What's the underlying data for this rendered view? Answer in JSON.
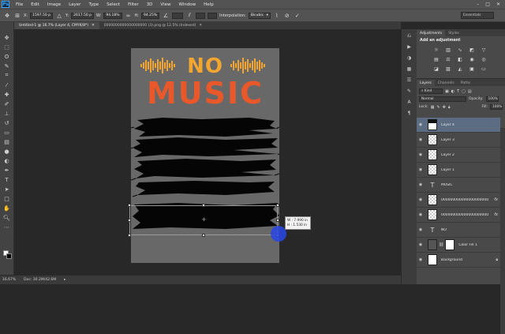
{
  "app": {
    "logo": "Ps"
  },
  "menu": [
    "File",
    "Edit",
    "Image",
    "Layer",
    "Type",
    "Select",
    "Filter",
    "3D",
    "View",
    "Window",
    "Help"
  ],
  "options": {
    "x_label": "X:",
    "x_value": "1597.50 p",
    "y_label": "Y:",
    "y_value": "2617.50 p",
    "w_label": "W:",
    "w_value": "94.18%",
    "h_label": "H:",
    "h_value": "94.25%",
    "interp_label": "Interpolation:",
    "interp_value": "Bicubic",
    "workspace": "Essentials"
  },
  "tabs": [
    {
      "label": "Untitled-1 @ 16.7% (Layer 4, CMYK/8*)",
      "active": true
    },
    {
      "label": "0000000000000000000 (3).png @ 12.5% (Indexed)",
      "active": false
    }
  ],
  "canvas": {
    "title_line1": "NO",
    "title_line2": "MUSIC",
    "transform_tooltip": {
      "w": "W : 7.990 in",
      "h": "H : 1.530 in"
    }
  },
  "status": {
    "zoom": "16.67%",
    "doc": "Doc: 30.2M/42.6M"
  },
  "right_panel": {
    "tabs": [
      "Adjustments",
      "Styles"
    ],
    "add_adjustment": "Add an adjustment",
    "layers_tabs": [
      "Layers",
      "Channels",
      "Paths"
    ],
    "kind": "Kind",
    "blend_mode": "Normal",
    "opacity_label": "Opacity:",
    "opacity_value": "100%",
    "lock_label": "Lock:",
    "fill_label": "Fill:",
    "fill_value": "100%"
  },
  "layers": [
    {
      "name": "Layer 4",
      "type": "pixel",
      "selected": true,
      "fx": false
    },
    {
      "name": "Layer 3",
      "type": "pixel",
      "selected": false,
      "fx": false
    },
    {
      "name": "Layer 2",
      "type": "pixel",
      "selected": false,
      "fx": false
    },
    {
      "name": "Layer 1",
      "type": "pixel",
      "selected": false,
      "fx": false
    },
    {
      "name": "MUSIC",
      "type": "text",
      "selected": false,
      "fx": false
    },
    {
      "name": "000000000000000000000",
      "type": "pixel",
      "selected": false,
      "fx": true
    },
    {
      "name": "000000000000000000000",
      "type": "pixel",
      "selected": false,
      "fx": true
    },
    {
      "name": "NO",
      "type": "text",
      "selected": false,
      "fx": false
    },
    {
      "name": "Color Fill 1",
      "type": "fill",
      "selected": false,
      "fx": false
    },
    {
      "name": "Background",
      "type": "background",
      "selected": false,
      "fx": false
    }
  ],
  "colors": {
    "accent_orange": "#e8582a",
    "accent_yellow": "#f2a531",
    "selection_blue": "#5c6c82"
  }
}
